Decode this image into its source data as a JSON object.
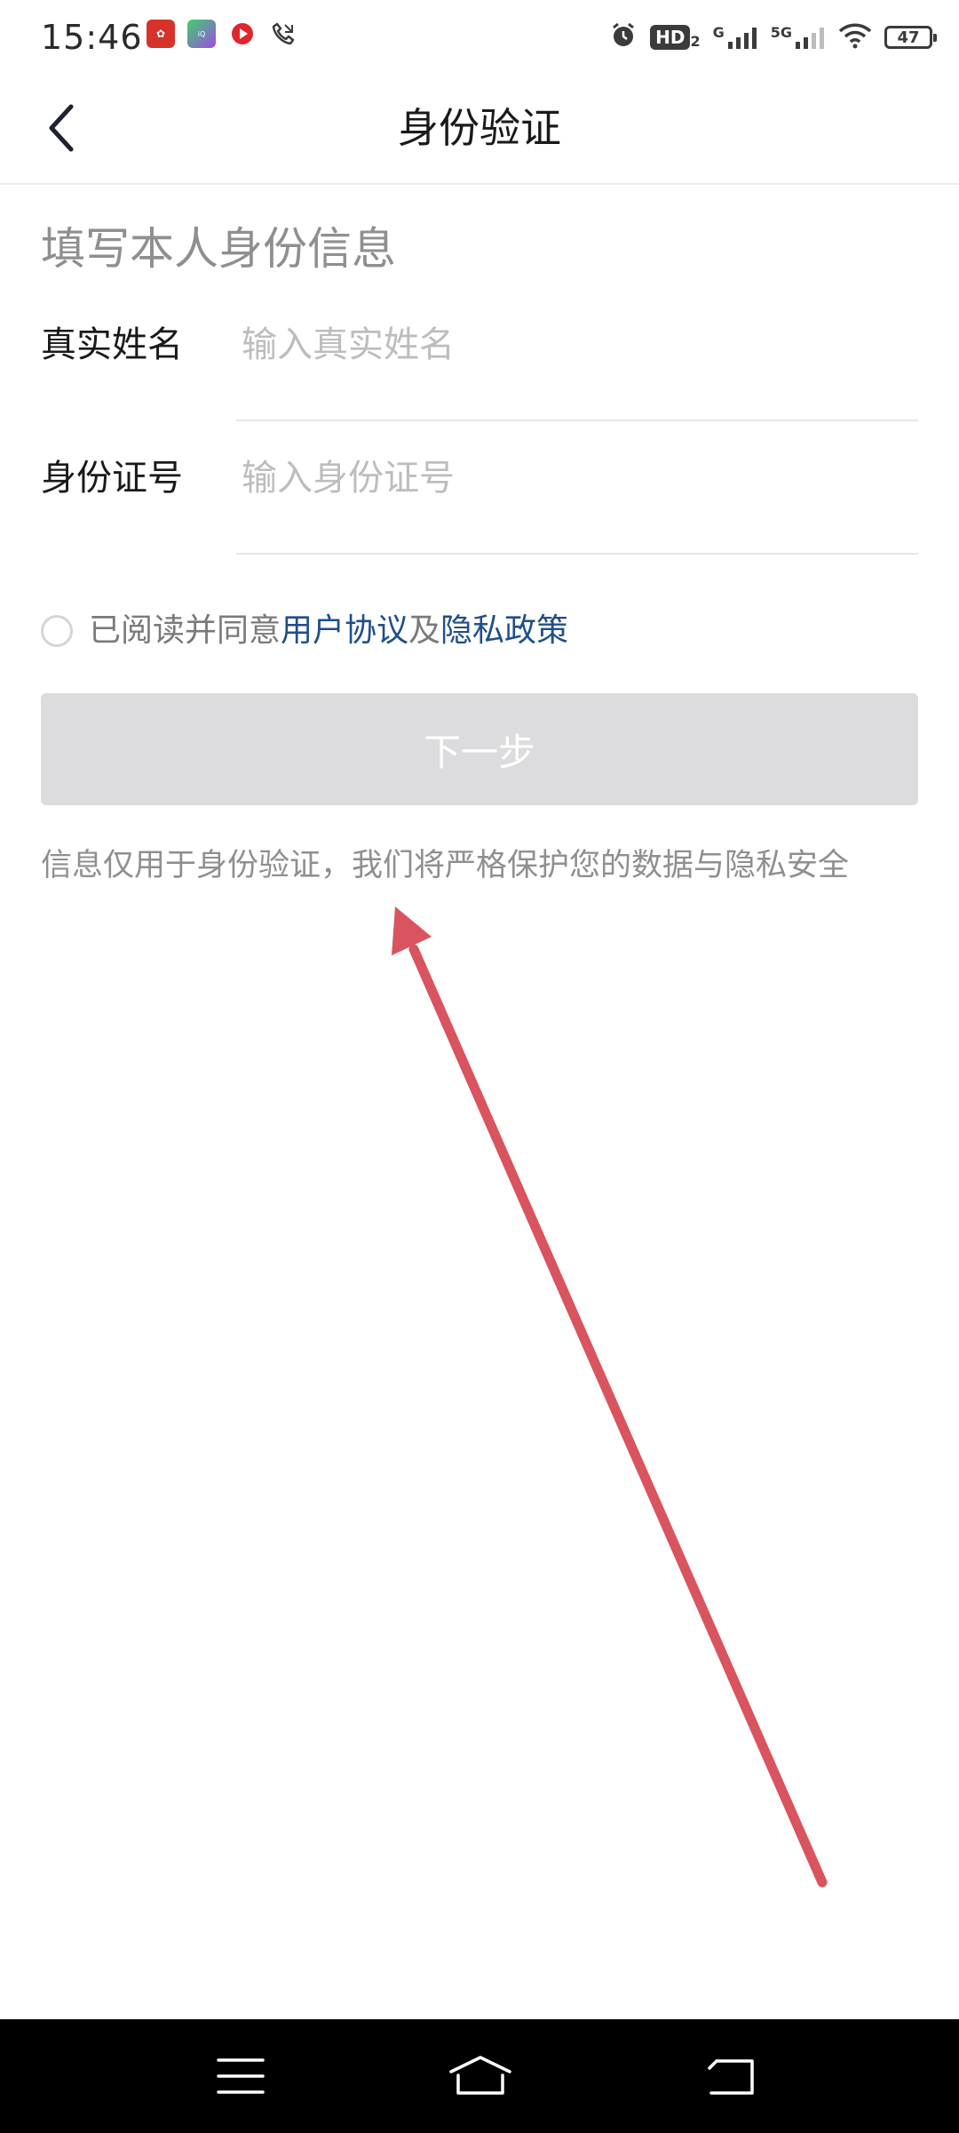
{
  "status_bar": {
    "time": "15:46",
    "hd_label": "HD",
    "hd_sub": "2",
    "net_1": "G",
    "net_2": "5G",
    "battery": "47"
  },
  "header": {
    "title": "身份验证"
  },
  "form": {
    "section_title": "填写本人身份信息",
    "name_label": "真实姓名",
    "name_placeholder": "输入真实姓名",
    "id_label": "身份证号",
    "id_placeholder": "输入身份证号"
  },
  "agreement": {
    "prefix": "已阅读并同意",
    "user_agreement": "用户协议",
    "and": "及",
    "privacy_policy": "隐私政策"
  },
  "actions": {
    "next_label": "下一步"
  },
  "info": {
    "text": "信息仅用于身份验证，我们将严格保护您的数据与隐私安全"
  },
  "colors": {
    "accent_link": "#1f4f8a",
    "disabled_button": "#dcdcde",
    "annotation_arrow": "#d9545e"
  }
}
